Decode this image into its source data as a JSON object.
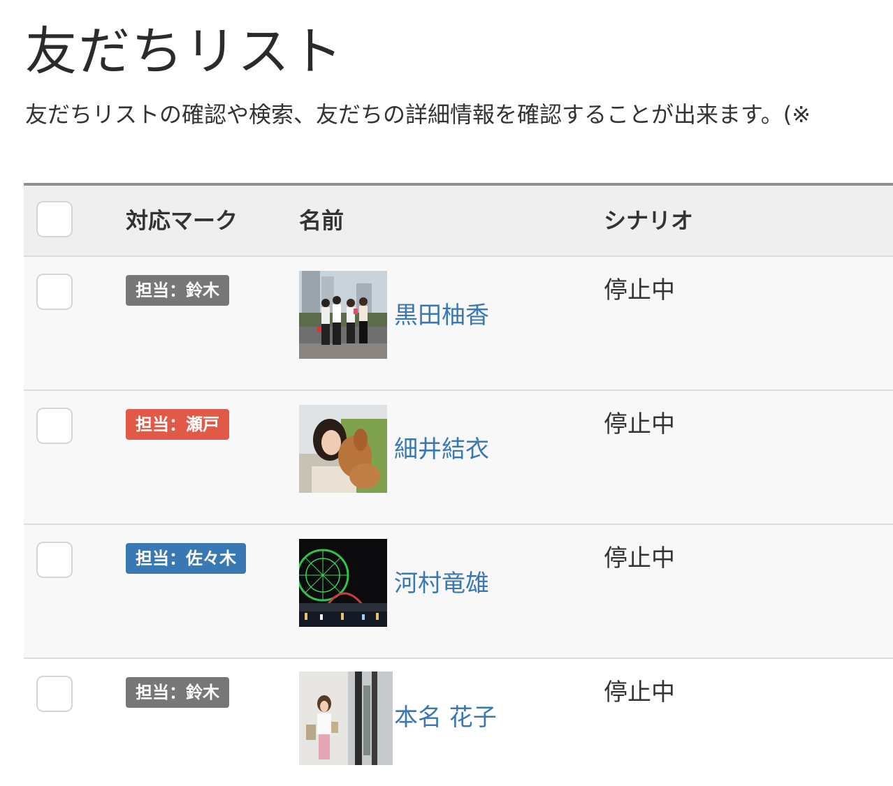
{
  "page": {
    "title": "友だちリスト",
    "description": "友だちリストの確認や検索、友だちの詳細情報を確認することが出来ます。(※"
  },
  "table": {
    "columns": {
      "mark": "対応マーク",
      "name": "名前",
      "scenario": "シナリオ"
    },
    "rows": [
      {
        "badge": "担当：鈴木",
        "badge_color": "#777777",
        "name": "黒田柚香",
        "scenario": "停止中",
        "thumb": "group-photo"
      },
      {
        "badge": "担当：瀬戸",
        "badge_color": "#e05a47",
        "name": "細井結衣",
        "scenario": "停止中",
        "thumb": "woman-with-dog-photo"
      },
      {
        "badge": "担当：佐々木",
        "badge_color": "#3a78b4",
        "name": "河村竜雄",
        "scenario": "停止中",
        "thumb": "ferris-wheel-night-photo"
      },
      {
        "badge": "担当：鈴木",
        "badge_color": "#777777",
        "name": "本名 花子",
        "scenario": "停止中",
        "thumb": "woman-shopping-photo"
      }
    ]
  },
  "colors": {
    "link": "#3a78b4",
    "header_bg": "#efefef",
    "row_bg": "#f8f8f8"
  }
}
